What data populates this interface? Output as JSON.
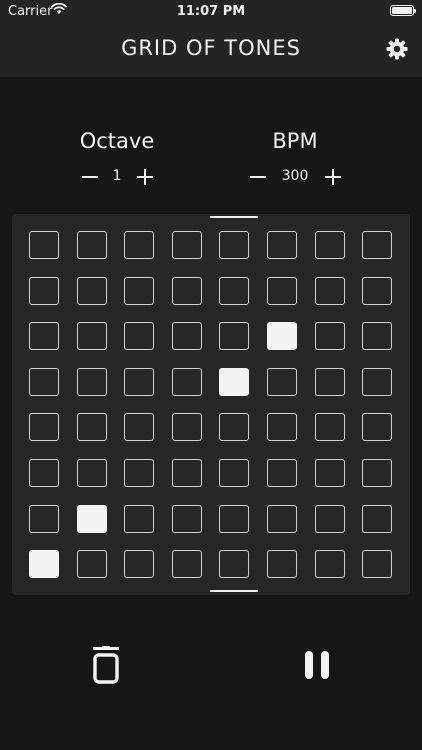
{
  "status_bar": {
    "carrier": "Carrier",
    "time": "11:07 PM"
  },
  "header": {
    "title": "GRID OF TONES",
    "settings_icon": "gear-icon"
  },
  "octave": {
    "label": "Octave",
    "value": "1",
    "decrement_icon": "minus-icon",
    "increment_icon": "plus-icon"
  },
  "bpm": {
    "label": "BPM",
    "value": "300",
    "decrement_icon": "minus-icon",
    "increment_icon": "plus-icon"
  },
  "grid": {
    "rows": 8,
    "cols": 8,
    "active_cells": [
      [
        2,
        5
      ],
      [
        3,
        4
      ],
      [
        6,
        1
      ],
      [
        7,
        0
      ]
    ]
  },
  "footer": {
    "clear_icon": "trash-icon",
    "playback_icon": "pause-icon"
  },
  "colors": {
    "background": "#161616",
    "bar": "#242424",
    "panel": "#262626",
    "accent": "#f4f4f4"
  }
}
